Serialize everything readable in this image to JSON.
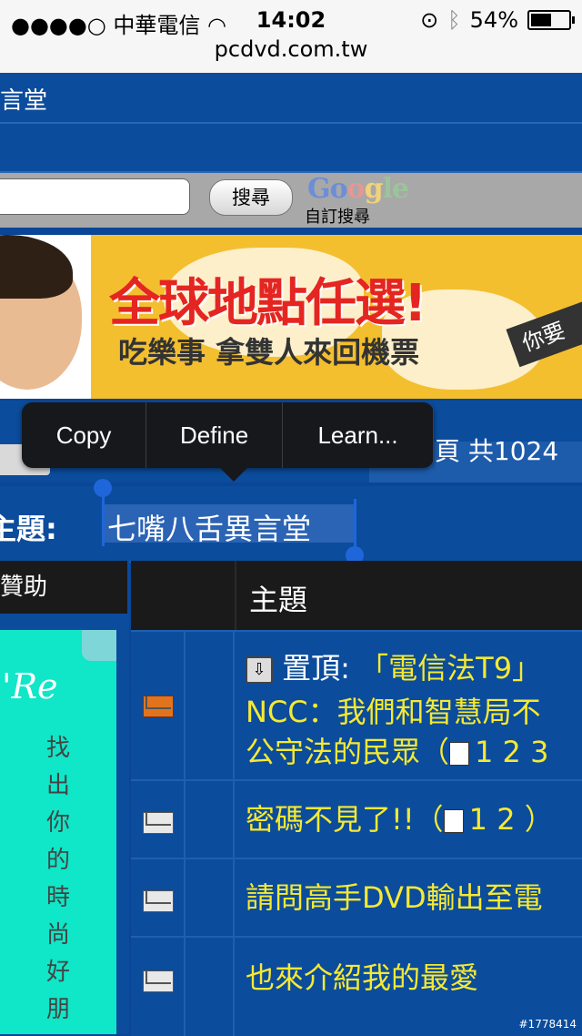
{
  "status_bar": {
    "signal": "●●●●○",
    "carrier": "中華電信",
    "time": "14:02",
    "battery": "54%",
    "url": "pcdvd.com.tw"
  },
  "header": {
    "forum_partial": "言堂"
  },
  "search": {
    "button": "搜尋",
    "google_brand": "Google",
    "custom_search": "自訂搜尋"
  },
  "banner": {
    "headline": "全球地點任選!",
    "subline": "吃樂事 拿雙人來回機票",
    "ribbon": "你要"
  },
  "pagination": {
    "text": "頁 共1024"
  },
  "context_menu": {
    "items": [
      "Copy",
      "Define",
      "Learn..."
    ]
  },
  "thread": {
    "label": "主題:",
    "selected_title": "七嘴八舌異言堂"
  },
  "sidebar": {
    "header": "贊助",
    "ad_text": "'Re",
    "ad_vertical": "找出你的時尚好朋"
  },
  "table": {
    "header": "主題",
    "rows": [
      {
        "prefix": "置頂:",
        "line1": "「電信法T9」",
        "line2": "NCC：我們和智慧局不",
        "line3": "公守法的民眾（",
        "pages": "1 2 3"
      },
      {
        "title": "密碼不見了!!（",
        "pages": "1 2 ）"
      },
      {
        "title": "請問高手DVD輸出至電"
      },
      {
        "title": "也來介紹我的最愛"
      }
    ]
  },
  "watermark": "#1778414"
}
